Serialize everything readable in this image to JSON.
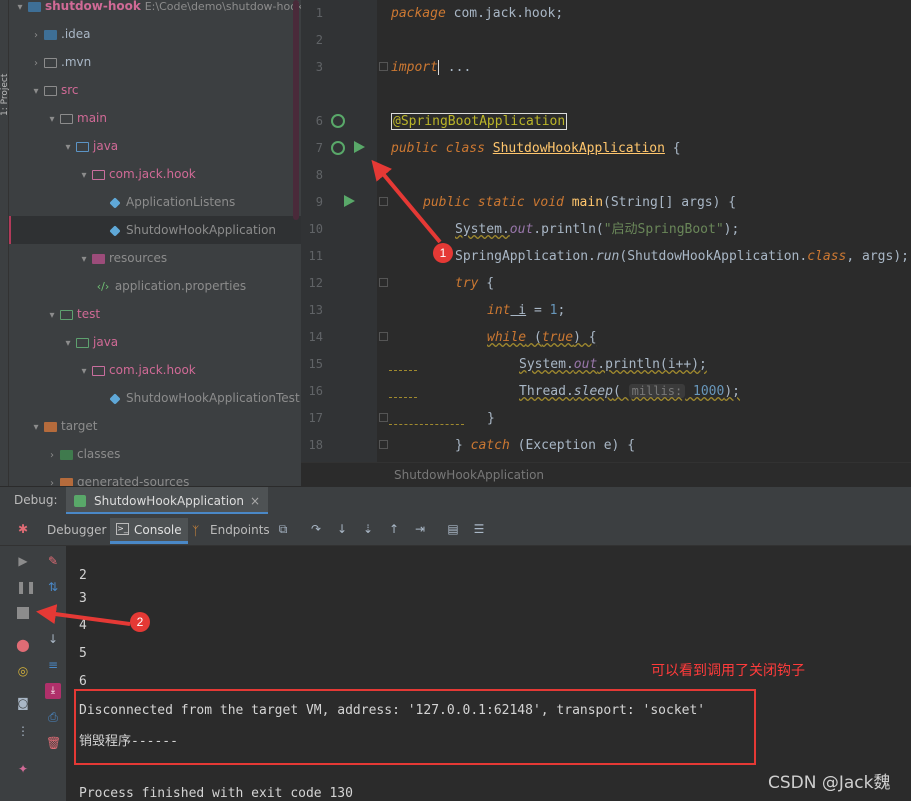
{
  "project": {
    "panel_tab": "1: Project",
    "root_name": "shutdow-hook",
    "root_path": "E:\\Code\\demo\\shutdow-hook",
    "tree": [
      {
        "label": ".idea",
        "indent": 1
      },
      {
        "label": ".mvn",
        "indent": 1
      },
      {
        "label": "src",
        "indent": 1
      },
      {
        "label": "main",
        "indent": 2
      },
      {
        "label": "java",
        "indent": 3
      },
      {
        "label": "com.jack.hook",
        "indent": 4
      },
      {
        "label": "ApplicationListens",
        "indent": 5
      },
      {
        "label": "ShutdowHookApplication",
        "indent": 5
      },
      {
        "label": "resources",
        "indent": 3
      },
      {
        "label": "application.properties",
        "indent": 4
      },
      {
        "label": "test",
        "indent": 2
      },
      {
        "label": "java",
        "indent": 3
      },
      {
        "label": "com.jack.hook",
        "indent": 4
      },
      {
        "label": "ShutdowHookApplicationTest",
        "indent": 5
      },
      {
        "label": "target",
        "indent": 1
      },
      {
        "label": "classes",
        "indent": 2
      },
      {
        "label": "generated-sources",
        "indent": 2
      }
    ]
  },
  "editor": {
    "line_numbers": [
      "1",
      "2",
      "3",
      "6",
      "7",
      "8",
      "9",
      "10",
      "11",
      "12",
      "13",
      "14",
      "15",
      "16",
      "17",
      "18"
    ],
    "code": {
      "l1_kw": "package",
      "l1_rest": " com.jack.hook;",
      "l3_kw": "import",
      "l3_rest": " ...",
      "l6_ann": "@SpringBootApplication",
      "l7_kw": "public class",
      "l7_cls": "ShutdowHookApplication",
      "l7_rest": " {",
      "l9_kw": "public static void",
      "l9_fn": "main",
      "l9_rest": "(String[] args) {",
      "l10_a": "System.",
      "l10_fld": "out",
      "l10_b": ".println(",
      "l10_str": "\"启动SpringBoot\"",
      "l10_c": ");",
      "l11_a": "SpringApplication.",
      "l11_fn": "run",
      "l11_b": "(ShutdowHookApplication.",
      "l11_kw": "class",
      "l11_c": ", args);",
      "l12_kw": "try",
      "l12_rest": " {",
      "l13_kw": "int",
      "l13_var": " i",
      "l13_rest": " = ",
      "l13_num": "1",
      "l13_end": ";",
      "l14_kw": "while",
      "l14_rest": " (",
      "l14_kw2": "true",
      "l14_end": ") {",
      "l15_a": "System.",
      "l15_fld": "out",
      "l15_b": ".println(i++);",
      "l16_a": "Thread.",
      "l16_fn": "sleep",
      "l16_b": "( ",
      "l16_hint": "millis:",
      "l16_num": " 1000",
      "l16_c": ");",
      "l17": "}",
      "l18_a": "} ",
      "l18_kw": "catch",
      "l18_b": " (Exception e) {"
    },
    "breadcrumb": "ShutdowHookApplication"
  },
  "debug": {
    "label": "Debug:",
    "tab_label": "ShutdowHookApplication",
    "tab_close": "×",
    "subtabs": {
      "debugger": "Debugger",
      "console": "Console",
      "endpoints": "Endpoints"
    }
  },
  "console": {
    "lines": [
      "2",
      "3",
      "4",
      "5",
      "6"
    ],
    "disconnected": "Disconnected from the target VM, address: '127.0.0.1:62148', transport: 'socket'",
    "destroy": "销毁程序------",
    "exit": "Process finished with exit code 130"
  },
  "annotations": {
    "note": "可以看到调用了关闭钩子",
    "badge1": "1",
    "badge2": "2",
    "watermark": "CSDN @Jack魏",
    "color": "#e53935"
  }
}
